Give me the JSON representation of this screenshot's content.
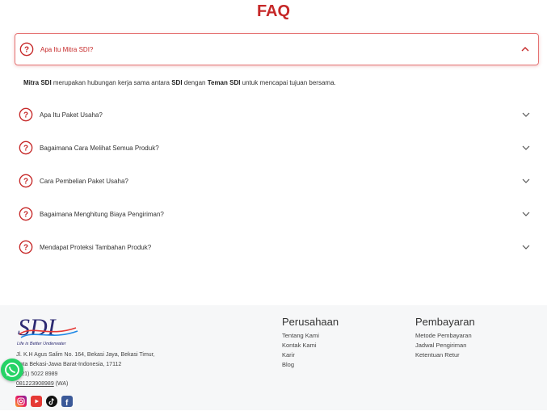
{
  "faq": {
    "title": "FAQ",
    "items": [
      {
        "question": "Apa Itu Mitra SDI?"
      },
      {
        "question": "Apa Itu Paket Usaha?"
      },
      {
        "question": "Bagaimana Cara Melihat Semua Produk?"
      },
      {
        "question": "Cara Pembelian Paket Usaha?"
      },
      {
        "question": "Bagaimana Menghitung Biaya Pengiriman?"
      },
      {
        "question": "Mendapat Proteksi Tambahan Produk?"
      }
    ],
    "answer": {
      "p1": "Mitra SDI",
      "p2": " merupakan hubungan kerja sama antara ",
      "p3": "SDI",
      "p4": " dengan ",
      "p5": "Teman SDI",
      "p6": " untuk mencapai tujuan bersama."
    }
  },
  "footer": {
    "logo_text": "SDI",
    "tagline": "Life is Better Underwater",
    "address_line1": "Jl. K.H Agus Salim No. 164, Bekasi Jaya, Bekasi Timur,",
    "address_line2": "Kota Bekasi-Jawa Barat-Indonesia, 17112",
    "phone": "(021) 5022 8989",
    "wa_number": "081223908989",
    "wa_suffix": " (WA)",
    "perusahaan": {
      "title": "Perusahaan",
      "links": [
        "Tentang Kami",
        "Kontak Kami",
        "Karir",
        "Blog"
      ]
    },
    "pembayaran": {
      "title": "Pembayaran",
      "links": [
        "Metode Pembayaran",
        "Jadwal Pengiriman",
        "Ketentuan Retur"
      ]
    },
    "social": [
      "instagram-icon",
      "youtube-icon",
      "tiktok-icon",
      "facebook-icon"
    ]
  },
  "colors": {
    "accent": "#c62828",
    "whatsapp": "#25d366"
  }
}
